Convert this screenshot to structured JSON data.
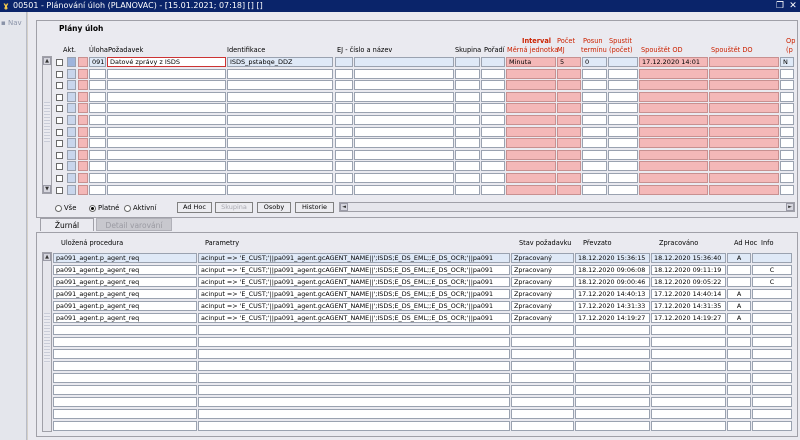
{
  "window": {
    "title": "00501 - Plánování úloh (PLANOVAC) - [15.01.2021; 07:18]  []  []",
    "icon": "app-logo-icon"
  },
  "nav": {
    "label": "Nav"
  },
  "group": {
    "title": "Plány úloh",
    "headers": {
      "akt": "Akt.",
      "uloha": "Úloha",
      "pozadavek": "Požadavek",
      "identifikace": "Identifikace",
      "ej": "EJ - číslo a název",
      "skupina": "Skupina",
      "poradi": "Pořadí",
      "interval": "Interval",
      "merna": "Měrná jednotka",
      "pocet": "Počet",
      "pocet_mj": "MJ",
      "posun": "Posun",
      "posun2": "termínu",
      "spusti": "Spustit",
      "spusti2": "(počet)",
      "spusteni_od": "Spouštět OD",
      "spusteni_do": "Spouštět DO",
      "opak": "Op",
      "opak2": "(p"
    },
    "rows": [
      {
        "uloha": "091",
        "pozadavek": "Datové zprávy z ISDS",
        "identifikace": "ISDS_pstabqe_DDZ",
        "merna": "Minuta",
        "pocet": "5",
        "posun": "0",
        "od": "17.12.2020 14:01",
        "opak": "N"
      }
    ]
  },
  "filters": {
    "vse": "Vše",
    "platne": "Platné",
    "aktivni": "Aktivní",
    "selected": "platne"
  },
  "buttons": {
    "adhoc": "Ad Hoc",
    "skupina": "Skupina",
    "osoby": "Osoby",
    "historie": "Historie"
  },
  "tabs": {
    "zurnal": "Žurnál",
    "detail": "Detail varování"
  },
  "journal": {
    "headers": {
      "procedura": "Uložená procedura",
      "parametry": "Parametry",
      "stav": "Stav požadavku",
      "prevzato": "Převzato",
      "zpracovano": "Zpracováno",
      "adhoc": "Ad Hoc",
      "info": "Info"
    },
    "rows": [
      {
        "procedura": "pa091_agent.p_agent_req",
        "parametry": "acinput => 'E_CUST;'||pa091_agent.gcAGENT_NAME||';ISDS;E_DS_EML;;E_DS_OCR;'||pa091",
        "stav": "Zpracovaný",
        "prevzato": "18.12.2020 15:36:15",
        "zpracovano": "18.12.2020 15:36:40",
        "adhoc": "A",
        "info": ""
      },
      {
        "procedura": "pa091_agent.p_agent_req",
        "parametry": "acinput => 'E_CUST;'||pa091_agent.gcAGENT_NAME||';ISDS;E_DS_EML;;E_DS_OCR;'||pa091",
        "stav": "Zpracovaný",
        "prevzato": "18.12.2020 09:06:08",
        "zpracovano": "18.12.2020 09:11:19",
        "adhoc": "",
        "info": "C"
      },
      {
        "procedura": "pa091_agent.p_agent_req",
        "parametry": "acinput => 'E_CUST;'||pa091_agent.gcAGENT_NAME||';ISDS;E_DS_EML;;E_DS_OCR;'||pa091",
        "stav": "Zpracovaný",
        "prevzato": "18.12.2020 09:00:46",
        "zpracovano": "18.12.2020 09:05:22",
        "adhoc": "",
        "info": "C"
      },
      {
        "procedura": "pa091_agent.p_agent_req",
        "parametry": "acinput => 'E_CUST;'||pa091_agent.gcAGENT_NAME||';ISDS;E_DS_EML;;E_DS_OCR;'||pa091",
        "stav": "Zpracovaný",
        "prevzato": "17.12.2020 14:40:13",
        "zpracovano": "17.12.2020 14:40:14",
        "adhoc": "A",
        "info": ""
      },
      {
        "procedura": "pa091_agent.p_agent_req",
        "parametry": "acinput => 'E_CUST;'||pa091_agent.gcAGENT_NAME||';ISDS;E_DS_EML;;E_DS_OCR;'||pa091",
        "stav": "Zpracovaný",
        "prevzato": "17.12.2020 14:31:33",
        "zpracovano": "17.12.2020 14:31:35",
        "adhoc": "A",
        "info": ""
      },
      {
        "procedura": "pa091_agent.p_agent_req",
        "parametry": "acinput => 'E_CUST;'||pa091_agent.gcAGENT_NAME||';ISDS;E_DS_EML;;E_DS_OCR;'||pa091",
        "stav": "Zpracovaný",
        "prevzato": "17.12.2020 14:19:27",
        "zpracovano": "17.12.2020 14:19:27",
        "adhoc": "A",
        "info": ""
      }
    ]
  }
}
